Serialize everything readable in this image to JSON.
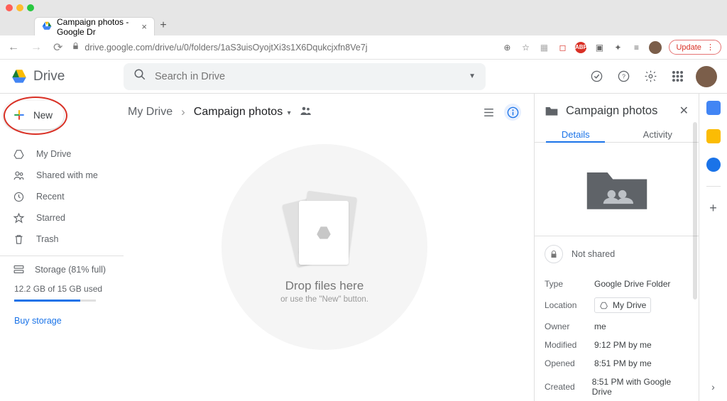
{
  "browser": {
    "tab_title": "Campaign photos - Google Dr",
    "url": "drive.google.com/drive/u/0/folders/1aS3uisOyojtXi3s1X6Dqukcjxfn8Ve7j",
    "update_label": "Update"
  },
  "header": {
    "app_name": "Drive",
    "search_placeholder": "Search in Drive"
  },
  "sidebar": {
    "new_label": "New",
    "items": [
      {
        "label": "My Drive"
      },
      {
        "label": "Shared with me"
      },
      {
        "label": "Recent"
      },
      {
        "label": "Starred"
      },
      {
        "label": "Trash"
      }
    ],
    "storage_label": "Storage (81% full)",
    "storage_used": "12.2 GB of 15 GB used",
    "buy_label": "Buy storage",
    "storage_percent": 81
  },
  "breadcrumb": {
    "root": "My Drive",
    "current": "Campaign photos"
  },
  "dropzone": {
    "line1": "Drop files here",
    "line2": "or use the \"New\" button."
  },
  "details": {
    "title": "Campaign photos",
    "tabs": {
      "details": "Details",
      "activity": "Activity"
    },
    "not_shared": "Not shared",
    "meta": {
      "type_k": "Type",
      "type_v": "Google Drive Folder",
      "location_k": "Location",
      "location_v": "My Drive",
      "owner_k": "Owner",
      "owner_v": "me",
      "modified_k": "Modified",
      "modified_v": "9:12 PM by me",
      "opened_k": "Opened",
      "opened_v": "8:51 PM by me",
      "created_k": "Created",
      "created_v": "8:51 PM with Google Drive"
    }
  }
}
